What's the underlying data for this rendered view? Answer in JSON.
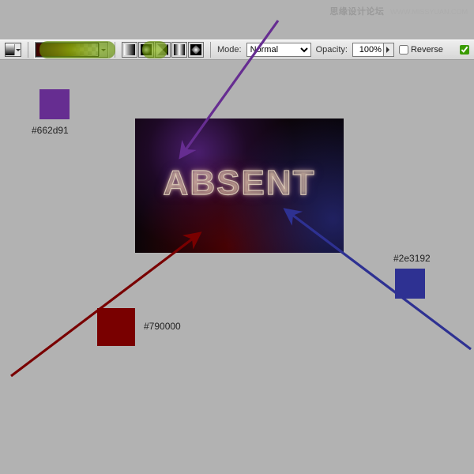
{
  "watermark": {
    "main": "思缘设计论坛",
    "sub": "WWW.MISSYUAN.COM"
  },
  "toolbar": {
    "mode_label": "Mode:",
    "mode_value": "Normal",
    "opacity_label": "Opacity:",
    "opacity_value": "100%",
    "reverse_label": "Reverse"
  },
  "swatches": {
    "purple": {
      "hex": "#662d91",
      "label": "#662d91"
    },
    "maroon": {
      "hex": "#790000",
      "label": "#790000"
    },
    "blue": {
      "hex": "#2e3192",
      "label": "#2e3192"
    }
  },
  "art": {
    "text": "ABSENT"
  },
  "icons": {
    "linear": "linear-icon",
    "radial": "radial-icon",
    "angle": "angle-icon",
    "reflected": "reflected-icon",
    "diamond": "diamond-icon"
  }
}
